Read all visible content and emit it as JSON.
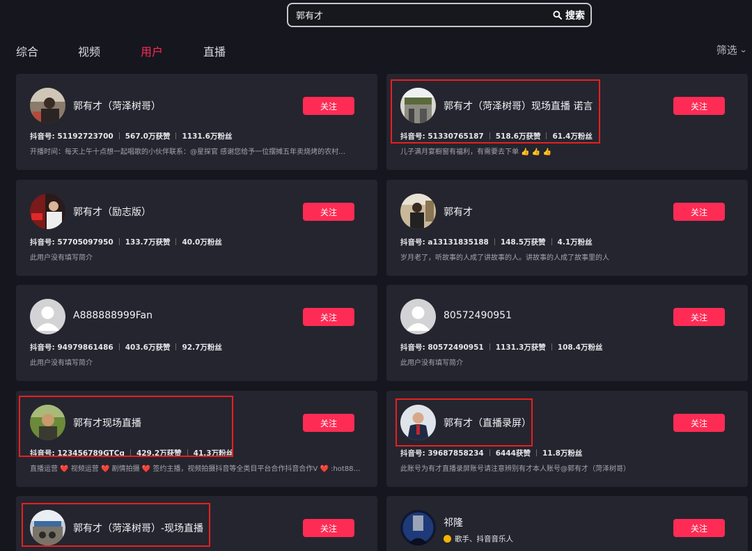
{
  "search": {
    "value": "郭有才",
    "button_label": "搜索"
  },
  "tabs": [
    {
      "label": "综合"
    },
    {
      "label": "视频"
    },
    {
      "label": "用户"
    },
    {
      "label": "直播"
    }
  ],
  "active_tab": "用户",
  "filter_label": "筛选",
  "follow_label": "关注",
  "colors": {
    "accent": "#fe2c55",
    "card_bg": "#25252f",
    "page_bg": "#16161f",
    "highlight": "#e8201f"
  },
  "users": [
    {
      "name": "郭有才（菏泽树哥）",
      "id": "抖音号: 51192723700",
      "likes": "567.0万获赞",
      "fans": "1131.6万粉丝",
      "bio": "开播时间：每天上午十点想一起唱歌的小伙伴联系：@星探官 感谢您给予一位摆摊五年卖烧烤的农村…"
    },
    {
      "name": "郭有才（菏泽树哥）现场直播 诺言",
      "id": "抖音号: 51330765187",
      "likes": "518.6万获赞",
      "fans": "61.4万粉丝",
      "bio": "儿子满月宴橱窗有福利，有需要去下单 👍 👍 👍"
    },
    {
      "name": "郭有才（励志版）",
      "id": "抖音号: 57705097950",
      "likes": "133.7万获赞",
      "fans": "40.0万粉丝",
      "bio": "此用户没有填写简介"
    },
    {
      "name": "郭有才",
      "id": "抖音号: a13131835188",
      "likes": "148.5万获赞",
      "fans": "4.1万粉丝",
      "bio": "岁月老了，听故事的人成了讲故事的人。讲故事的人成了故事里的人"
    },
    {
      "name": "A888888999Fan",
      "id": "抖音号: 94979861486",
      "likes": "403.6万获赞",
      "fans": "92.7万粉丝",
      "bio": "此用户没有填写简介"
    },
    {
      "name": "80572490951",
      "id": "抖音号: 80572490951",
      "likes": "1131.3万获赞",
      "fans": "108.4万粉丝",
      "bio": "此用户没有填写简介"
    },
    {
      "name": "郭有才现场直播",
      "id": "抖音号: 123456789GTCg",
      "likes": "429.2万获赞",
      "fans": "41.3万粉丝",
      "bio": "直播运营 ❤️ 视频运营 ❤️ 剧情拍摄 ❤️ 签约主播，视频拍摄抖音等全类目平台合作抖音合作V ❤️ :hot88…"
    },
    {
      "name": "郭有才（直播录屏）",
      "id": "抖音号: 39687858234",
      "likes": "6444获赞",
      "fans": "11.8万粉丝",
      "bio": "此账号为有才直播录屏账号请注意辨别有才本人账号@郭有才（菏泽树哥）"
    },
    {
      "name": "郭有才（菏泽树哥）-现场直播"
    },
    {
      "name": "祁隆",
      "verified": "歌手、抖音音乐人"
    }
  ]
}
